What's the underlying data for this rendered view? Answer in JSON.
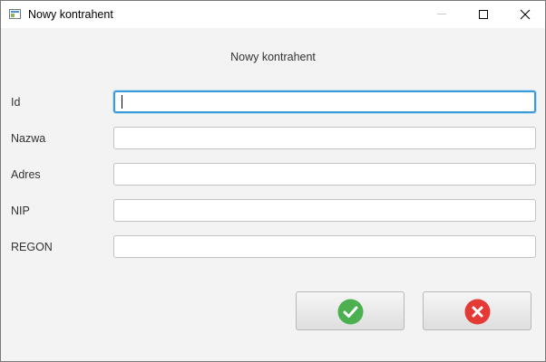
{
  "window": {
    "title": "Nowy kontrahent"
  },
  "title_bar_buttons": {
    "minimize_icon": "minimize-icon",
    "maximize_icon": "maximize-icon",
    "close_icon": "close-icon"
  },
  "form": {
    "heading": "Nowy kontrahent",
    "fields": [
      {
        "label": "Id",
        "value": "",
        "focused": true
      },
      {
        "label": "Nazwa",
        "value": ""
      },
      {
        "label": "Adres",
        "value": ""
      },
      {
        "label": "NIP",
        "value": ""
      },
      {
        "label": "REGON",
        "value": ""
      }
    ]
  },
  "actions": {
    "confirm_icon": "checkmark-icon",
    "confirm_color": "#4caf50",
    "cancel_icon": "close-icon",
    "cancel_color": "#e53935"
  },
  "colors": {
    "focus_border": "#3a9ad9",
    "background": "#f3f3f3"
  }
}
